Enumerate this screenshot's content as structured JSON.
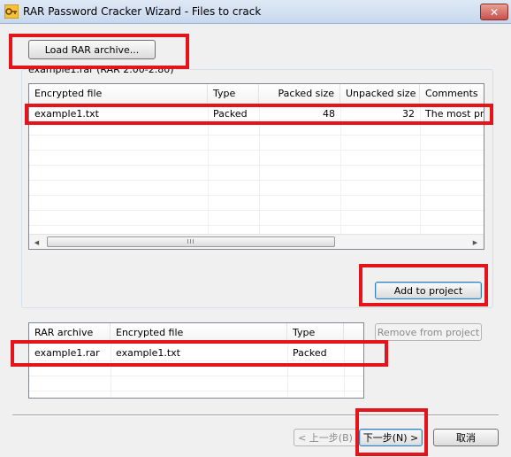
{
  "window": {
    "title": "RAR Password Cracker Wizard - Files to crack"
  },
  "load_button": {
    "label": "Load RAR archive..."
  },
  "archive_group": {
    "label": "example1.rar (RAR 2.00-2.80)"
  },
  "encrypted_list": {
    "columns": [
      "Encrypted file",
      "Type",
      "Packed size",
      "Unpacked size",
      "Comments"
    ],
    "rows": [
      {
        "file": "example1.txt",
        "type": "Packed",
        "packed": "48",
        "unpacked": "32",
        "comments": "The most pref"
      }
    ]
  },
  "add_button": {
    "label": "Add to project"
  },
  "remove_button": {
    "label": "Remove from project"
  },
  "project_list": {
    "columns": [
      "RAR archive",
      "Encrypted file",
      "Type"
    ],
    "rows": [
      {
        "archive": "example1.rar",
        "file": "example1.txt",
        "type": "Packed"
      }
    ]
  },
  "nav": {
    "back": "< 上一步(B)",
    "next": "下一步(N) >",
    "cancel": "取消"
  },
  "colors": {
    "highlight": "#e4141a"
  }
}
